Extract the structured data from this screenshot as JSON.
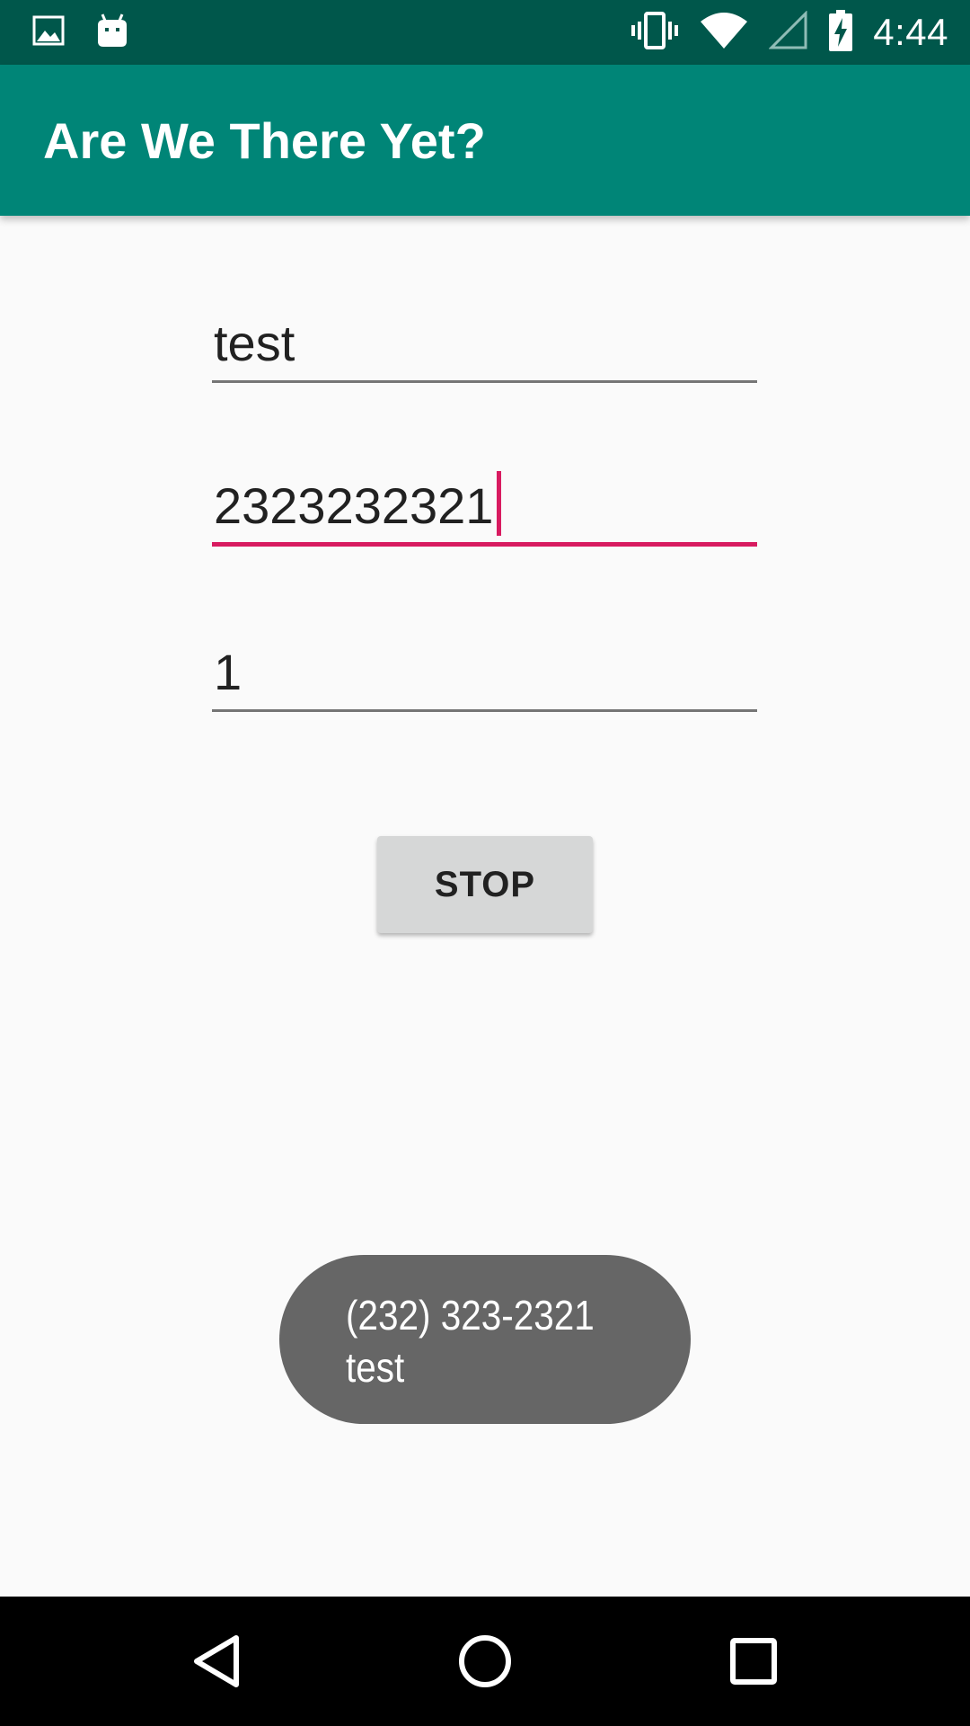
{
  "status_bar": {
    "time": "4:44",
    "left_icons": [
      "image-icon",
      "android-icon"
    ],
    "right_icons": [
      "vibrate-icon",
      "wifi-icon",
      "cell-signal-icon",
      "battery-charging-icon"
    ]
  },
  "app_bar": {
    "title": "Are We There Yet?",
    "color": "#008577",
    "status_color": "#00574b"
  },
  "form": {
    "field1_value": "test",
    "field2_value": "2323232321",
    "field3_value": "1",
    "accent_color": "#d81b60"
  },
  "button": {
    "label": "STOP"
  },
  "toast": {
    "line1": "(232) 323-2321",
    "line2": "test"
  },
  "nav_bar": {
    "buttons": [
      "back-icon",
      "home-icon",
      "recents-icon"
    ]
  }
}
